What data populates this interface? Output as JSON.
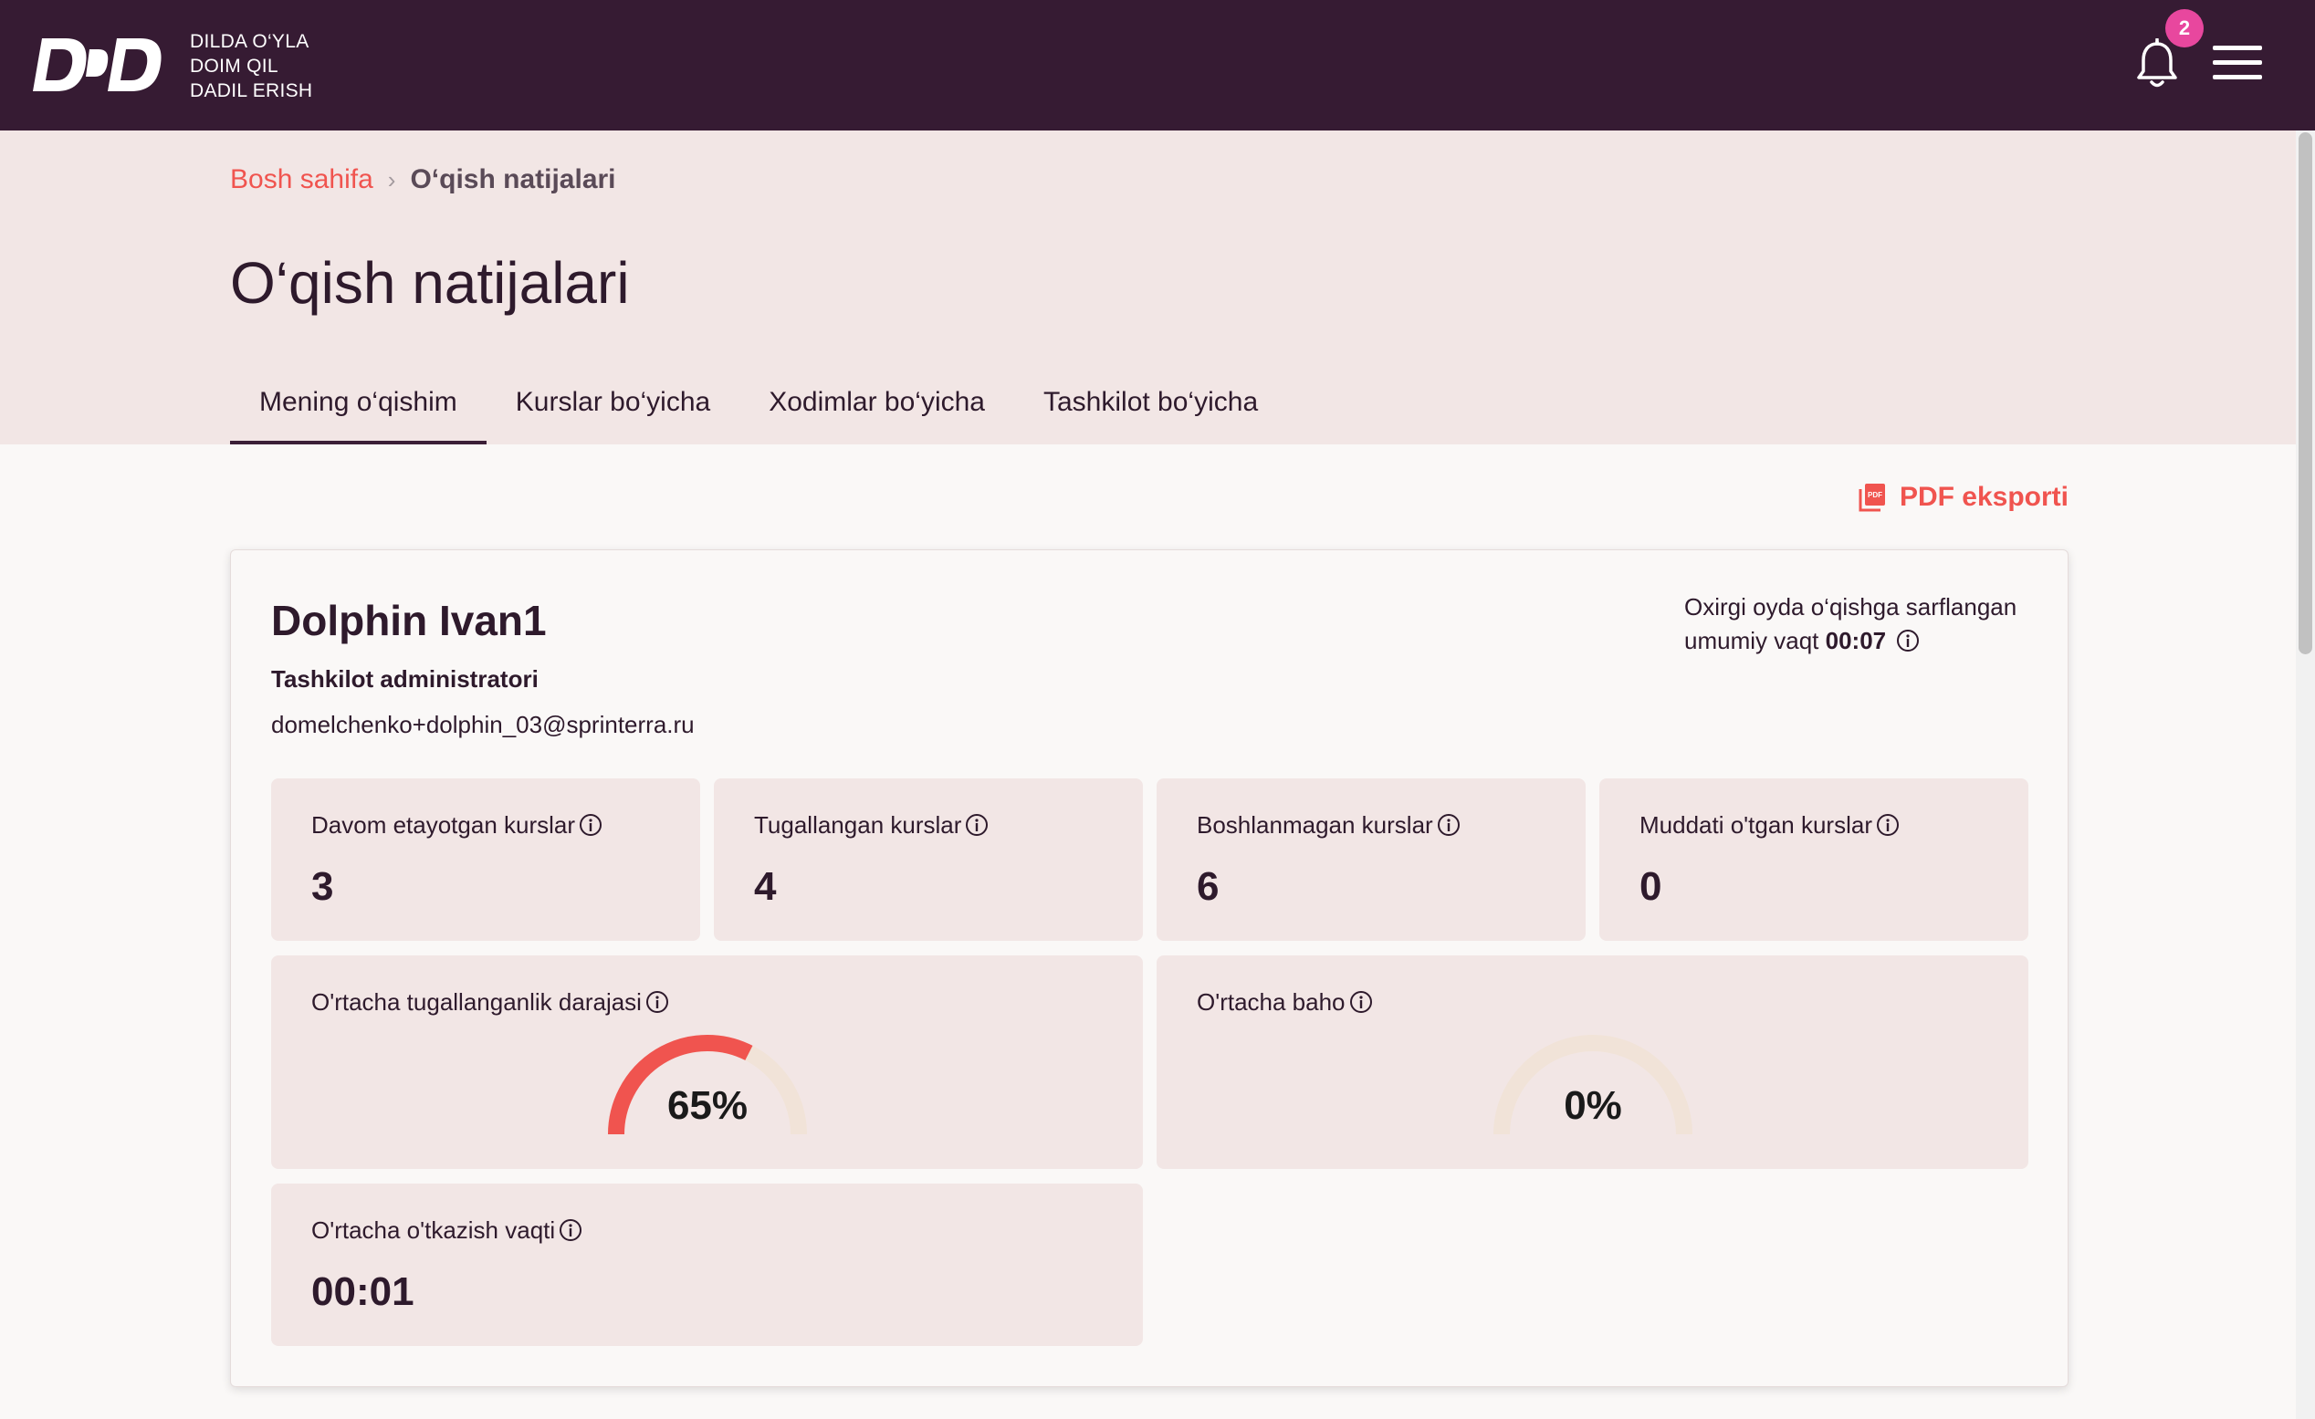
{
  "app": {
    "tagline": [
      "DILDA O‘YLA",
      "DOIM QIL",
      "DADIL ERISH"
    ],
    "notification_count": "2"
  },
  "breadcrumb": {
    "home": "Bosh sahifa",
    "current": "O‘qish natijalari"
  },
  "page_title": "O‘qish natijalari",
  "tabs": [
    {
      "label": "Mening o‘qishim",
      "active": true
    },
    {
      "label": "Kurslar bo‘yicha",
      "active": false
    },
    {
      "label": "Xodimlar bo‘yicha",
      "active": false
    },
    {
      "label": "Tashkilot bo‘yicha",
      "active": false
    }
  ],
  "export_label": "PDF eksporti",
  "user": {
    "name": "Dolphin Ivan1",
    "role": "Tashkilot administratori",
    "email": "domelchenko+dolphin_03@sprinterra.ru"
  },
  "monthly_time": {
    "label_line1": "Oxirgi oyda o‘qishga sarflangan",
    "label_line2": "umumiy vaqt",
    "value": "00:07"
  },
  "stats": [
    {
      "label": "Davom etayotgan kurslar",
      "value": "3"
    },
    {
      "label": "Tugallangan kurslar",
      "value": "4"
    },
    {
      "label": "Boshlanmagan kurslar",
      "value": "6"
    },
    {
      "label": "Muddati o'tgan kurslar",
      "value": "0"
    }
  ],
  "completion": {
    "label": "O'rtacha tugallanganlik darajasi",
    "percent": 65,
    "text": "65%"
  },
  "grade": {
    "label": "O'rtacha baho",
    "percent": 0,
    "text": "0%"
  },
  "avg_time": {
    "label": "O'rtacha o'tkazish vaqti",
    "value": "00:01"
  },
  "colors": {
    "topbar": "#361b33",
    "accent": "#f0544f",
    "badge": "#e8479e",
    "tile_bg": "#f2e6e5",
    "gauge_track": "#f1e3d8"
  },
  "icons": [
    "ddd-logo-icon",
    "bell-icon",
    "hamburger-menu-icon",
    "chevron-right-icon",
    "pdf-icon",
    "info-icon"
  ]
}
